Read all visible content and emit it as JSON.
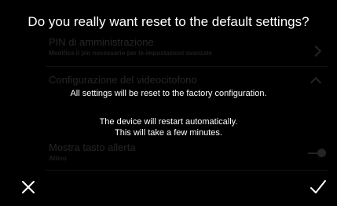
{
  "dialog": {
    "title": "Do you really want reset to the default settings?",
    "message_line1": "All settings will be reset to the factory configuration.",
    "message_line2": "The device will restart automatically.",
    "message_line3": "This will take a few minutes."
  },
  "background_list": {
    "items": [
      {
        "title": "PIN di amministrazione",
        "subtitle": "Modifica il pin necessario per le impostazioni avanzate"
      },
      {
        "title": "Configurazione del videocitofono",
        "subtitle": ""
      },
      {
        "title": "Mostra tasto allerta",
        "subtitle": "Attivo"
      }
    ]
  },
  "buttons": {
    "cancel_icon": "close-icon",
    "confirm_icon": "check-icon"
  },
  "colors": {
    "background": "#000000",
    "text": "#ffffff"
  }
}
